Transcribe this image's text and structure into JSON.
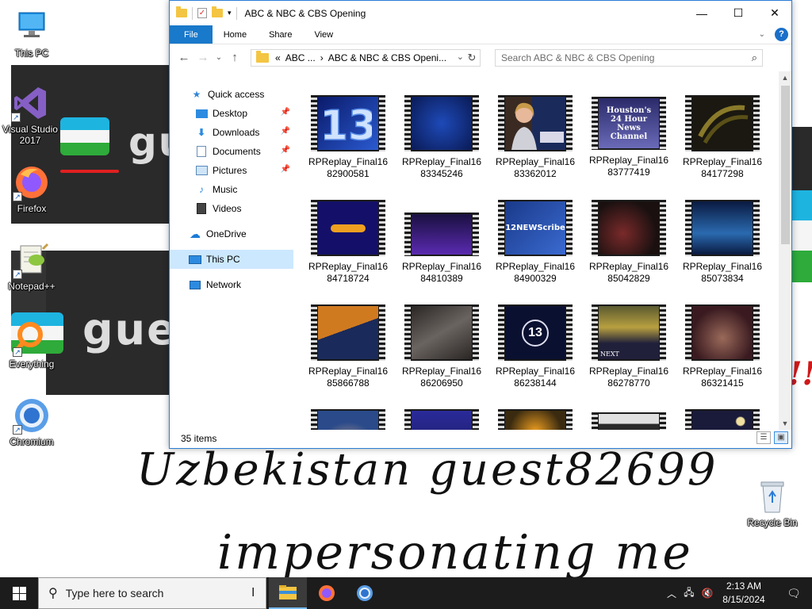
{
  "desktop": {
    "icons": [
      {
        "label": "This PC",
        "icon": "this-pc-icon"
      },
      {
        "label": "Visual Studio 2017",
        "icon": "visual-studio-icon"
      },
      {
        "label": "Firefox",
        "icon": "firefox-icon"
      },
      {
        "label": "Notepad++",
        "icon": "notepad-plus-plus-icon"
      },
      {
        "label": "Everything",
        "icon": "everything-search-icon"
      },
      {
        "label": "Chromium",
        "icon": "chromium-icon"
      },
      {
        "label": "Recycle Bin",
        "icon": "recycle-bin-icon"
      }
    ],
    "wallpaper": {
      "guest_fragment_1": "gu",
      "guest_fragment_2": "gues",
      "handwriting_line_1": "Uzbekistan guest82699",
      "handwriting_line_2": "impersonating me",
      "exclaim": "!!"
    }
  },
  "window": {
    "title": "ABC & NBC & CBS Opening",
    "controls": {
      "minimize": "—",
      "maximize": "☐",
      "close": "✕"
    },
    "ribbon_tabs": [
      "File",
      "Home",
      "Share",
      "View"
    ],
    "help": "?",
    "address": {
      "prefix": "«",
      "crumb_1": "ABC ...",
      "separator": "›",
      "crumb_2": "ABC & NBC & CBS Openi..."
    },
    "search_placeholder": "Search ABC & NBC & CBS Opening",
    "nav": {
      "quick_access": "Quick access",
      "desktop": "Desktop",
      "downloads": "Downloads",
      "documents": "Documents",
      "pictures": "Pictures",
      "music": "Music",
      "videos": "Videos",
      "onedrive": "OneDrive",
      "this_pc": "This PC",
      "network": "Network"
    },
    "files": [
      {
        "line1": "RPReplay_Final16",
        "line2": "82900581"
      },
      {
        "line1": "RPReplay_Final16",
        "line2": "83345246"
      },
      {
        "line1": "RPReplay_Final16",
        "line2": "83362012"
      },
      {
        "line1": "RPReplay_Final16",
        "line2": "83777419"
      },
      {
        "line1": "RPReplay_Final16",
        "line2": "84177298"
      },
      {
        "line1": "RPReplay_Final16",
        "line2": "84718724"
      },
      {
        "line1": "RPReplay_Final16",
        "line2": "84810389"
      },
      {
        "line1": "RPReplay_Final16",
        "line2": "84900329"
      },
      {
        "line1": "RPReplay_Final16",
        "line2": "85042829"
      },
      {
        "line1": "RPReplay_Final16",
        "line2": "85073834"
      },
      {
        "line1": "RPReplay_Final16",
        "line2": "85866788"
      },
      {
        "line1": "RPReplay_Final16",
        "line2": "86206950"
      },
      {
        "line1": "RPReplay_Final16",
        "line2": "86238144"
      },
      {
        "line1": "RPReplay_Final16",
        "line2": "86278770"
      },
      {
        "line1": "RPReplay_Final16",
        "line2": "86321415"
      }
    ],
    "thumb_texts": {
      "t3": "Houston's 24 Hour News Channel",
      "t7": "12NEWScribe",
      "t12": "13",
      "t13": "NEXT"
    },
    "status": "35 items"
  },
  "taskbar": {
    "search_placeholder": "Type here to search",
    "time": "2:13 AM",
    "date": "8/15/2024"
  },
  "colors": {
    "accent": "#1979ca",
    "selection": "#cce8ff",
    "taskbar": "#1c1c1c",
    "wallpaper_panel": "#2a2a2a"
  }
}
